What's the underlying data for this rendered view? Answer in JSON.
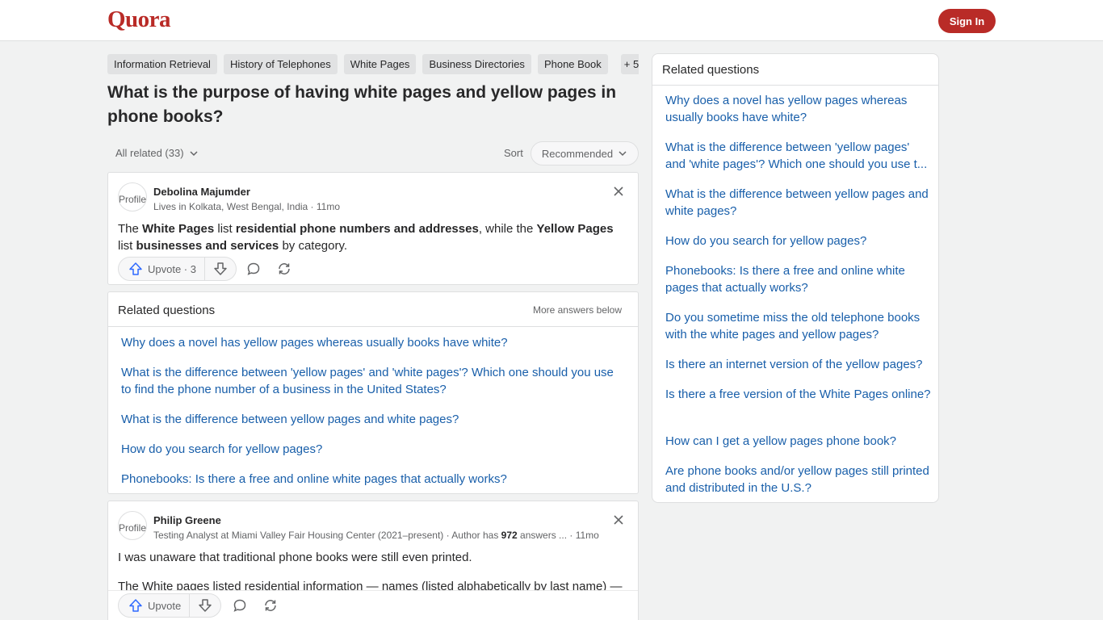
{
  "header": {
    "logo": "Quora",
    "signin": "Sign In"
  },
  "topics": [
    "Information Retrieval",
    "History of Telephones",
    "White Pages",
    "Business Directories",
    "Phone Book"
  ],
  "topics_more": "+ 5",
  "question": "What is the purpose of having white pages and yellow pages in phone books?",
  "filter": {
    "all_related": "All related (33)",
    "sort_label": "Sort",
    "sort_value": "Recommended"
  },
  "answer1": {
    "avatar_alt": "Profile",
    "author": "Debolina Majumder",
    "credential": "Lives in Kolkata, West Bengal, India · 11mo",
    "text": {
      "t1": "The ",
      "b1": "White Pages",
      "t2": " list ",
      "b2": "residential phone numbers and addresses",
      "t3": ", while the ",
      "b3": "Yellow Pages",
      "t4": " list ",
      "b4": "businesses and services",
      "t5": " by category."
    },
    "upvote": "Upvote · 3"
  },
  "inline_related": {
    "title": "Related questions",
    "more": "More answers below",
    "items": [
      "Why does a novel has yellow pages whereas usually books have white?",
      "What is the difference between 'yellow pages' and 'white pages'? Which one should you use to find the phone number of a business in the United States?",
      "What is the difference between yellow pages and white pages?",
      "How do you search for yellow pages?",
      "Phonebooks: Is there a free and online white pages that actually works?"
    ]
  },
  "answer2": {
    "avatar_alt": "Profile",
    "author": "Philip Greene",
    "credential_prefix": "Testing Analyst at Miami Valley Fair Housing Center (2021–present) · Author has ",
    "credential_count": "972",
    "credential_suffix": " answers ...",
    "time": " · 11mo",
    "p1": "I was unaware that traditional phone books were still even printed.",
    "p2": "The White pages listed residential information — names (listed alphabetically by last name) —",
    "upvote": "Upvote"
  },
  "sidebar": {
    "title": "Related questions",
    "items": [
      "Why does a novel has yellow pages whereas usually books have white?",
      "What is the difference between 'yellow pages' and 'white pages'? Which one should you use t...",
      "What is the difference between yellow pages and white pages?",
      "How do you search for yellow pages?",
      "Phonebooks: Is there a free and online white pages that actually works?",
      "Do you sometime miss the old telephone books with the white pages and yellow pages?",
      "Is there an internet version of the yellow pages?",
      "Is there a free version of the White Pages online?",
      "How can I get a yellow pages phone book?",
      "Are phone books and/or yellow pages still printed and distributed in the U.S.?"
    ]
  },
  "colors": {
    "brand": "#b92b27",
    "link": "#195faa",
    "upvote_blue": "#2e69ff"
  }
}
